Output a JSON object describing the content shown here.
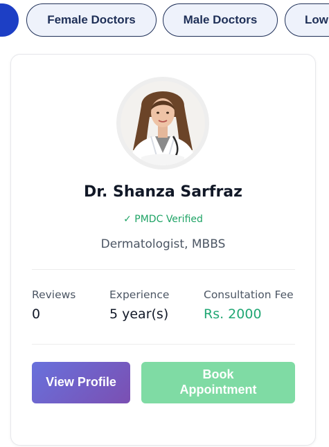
{
  "filters": {
    "chips": [
      {
        "label": ""
      },
      {
        "label": "Female Doctors"
      },
      {
        "label": "Male Doctors"
      },
      {
        "label": "Low"
      }
    ]
  },
  "doctor": {
    "name": "Dr. Shanza Sarfraz",
    "verified": "✓ PMDC Verified",
    "specialty": "Dermatologist, MBBS",
    "avatar_icon": "doctor-photo",
    "stats": {
      "reviews_label": "Reviews",
      "reviews_value": "0",
      "experience_label": "Experience",
      "experience_value": "5 year(s)",
      "fee_label": "Consultation Fee",
      "fee_value": "Rs. 2000"
    },
    "actions": {
      "view_profile": "View Profile",
      "book_appointment": "Book Appointment"
    }
  },
  "colors": {
    "chip_active": "#1d3fc5",
    "chip_border": "#1e2f57",
    "verified_green": "#1ea365",
    "fee_green": "#21a774",
    "view_profile_gradient_start": "#6871dc",
    "view_profile_gradient_end": "#7b4fb2",
    "book_button": "#7fdba4"
  }
}
